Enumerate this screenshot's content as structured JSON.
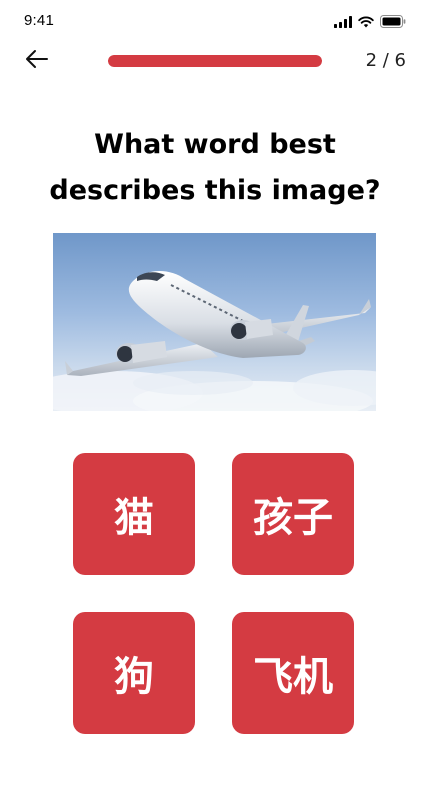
{
  "status_bar": {
    "time": "9:41",
    "icons": [
      "signal-icon",
      "wifi-icon",
      "battery-icon"
    ]
  },
  "header": {
    "back_icon": "arrow-left-icon",
    "progress": {
      "current": 2,
      "total": 6,
      "fraction": 1.0,
      "label": "2 / 6"
    }
  },
  "question": {
    "title": "What word best describes this image?",
    "image": "airplane-photo"
  },
  "answers": [
    {
      "label": "猫"
    },
    {
      "label": "孩子"
    },
    {
      "label": "狗"
    },
    {
      "label": "飞机"
    }
  ],
  "colors": {
    "accent": "#d43b42",
    "background": "#ffffff",
    "text": "#000000"
  }
}
